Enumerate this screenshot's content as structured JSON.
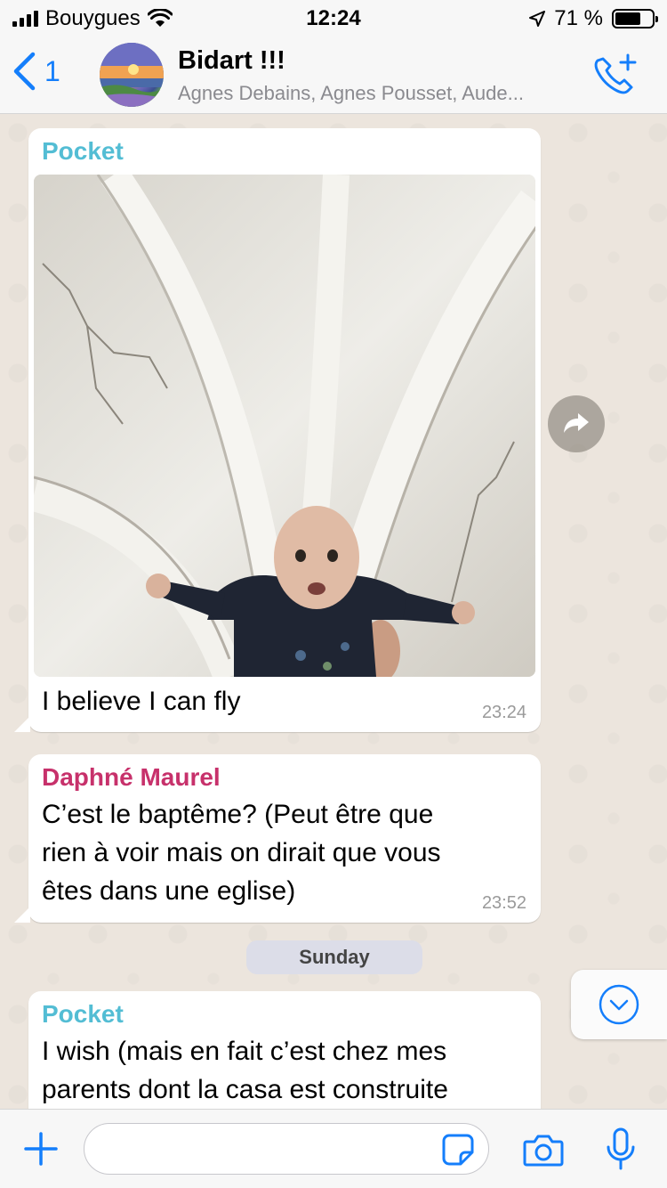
{
  "status_bar": {
    "carrier": "Bouygues",
    "time": "12:24",
    "battery": "71 %",
    "battery_level": 0.71
  },
  "header": {
    "back_count": "1",
    "title": "Bidart !!!",
    "members": "Agnes Debains, Agnes Pousset, Aude..."
  },
  "messages": [
    {
      "sender": "Pocket",
      "sender_color": "#53bdd4",
      "text": "I believe I can fly",
      "time": "23:24",
      "has_photo": true
    },
    {
      "sender": "Daphné Maurel",
      "sender_color": "#c7316b",
      "lines": [
        "C’est le baptême? (Peut être que",
        "rien à  voir mais on dirait que vous",
        "êtes dans une eglise)"
      ],
      "time": "23:52"
    },
    {
      "sender": "Pocket",
      "sender_color": "#53bdd4",
      "lines": [
        "I wish (mais en fait c’est chez mes",
        "parents dont la casa est construite"
      ]
    }
  ],
  "day_separator": "Sunday",
  "input": {
    "placeholder": ""
  },
  "colors": {
    "accent": "#147efb",
    "chat_background": "#ece5dd"
  }
}
